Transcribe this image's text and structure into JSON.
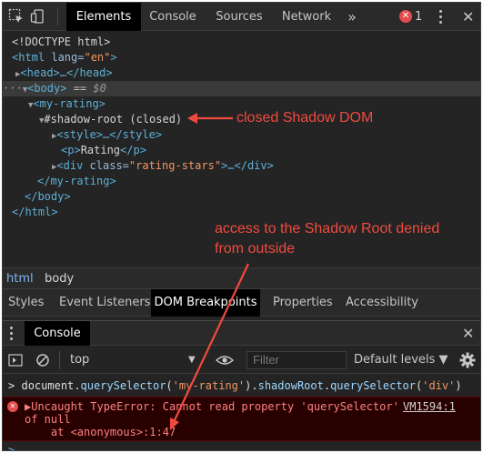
{
  "toolbar": {
    "inspect_icon": "inspect-cursor-icon",
    "device_icon": "device-toggle-icon",
    "tabs": [
      "Elements",
      "Console",
      "Sources",
      "Network"
    ],
    "overflow": "»",
    "error_count": "1",
    "accent_color": "#e34d4d"
  },
  "tree": {
    "doctype": "<!DOCTYPE html>",
    "html_open_tag": "<html",
    "html_lang_attr": " lang=",
    "html_lang_val": "\"en\"",
    "html_close_bracket": ">",
    "head": "<head>…</head>",
    "body_prefix": "···",
    "body_tag": "<body>",
    "body_suffix": " == ",
    "body_var": "$0",
    "my_rating_open": "<my-rating>",
    "shadow_root": "#shadow-root (closed)",
    "style": "<style>…</style>",
    "p_open": "<p>",
    "p_text": "Rating",
    "p_close": "</p>",
    "div_open": "<div",
    "div_class_attr": " class=",
    "div_class_val": "\"rating-stars\"",
    "div_rest": ">…</div>",
    "my_rating_close": "</my-rating>",
    "body_close": "</body>",
    "html_close": "</html>"
  },
  "annotations": {
    "shadow_label": "closed Shadow DOM",
    "denied_line1": "access to the Shadow Root denied",
    "denied_line2": "from outside",
    "color": "#f04a3f"
  },
  "breadcrumb": [
    "html",
    "body"
  ],
  "subtabs": [
    "Styles",
    "Event Listeners",
    "DOM Breakpoints",
    "Properties",
    "Accessibility"
  ],
  "drawer": {
    "title": "Console",
    "context": "top",
    "filter_placeholder": "Filter",
    "levels": "Default levels ▼"
  },
  "console": {
    "prompt": ">",
    "cmd_p1": "document.",
    "cmd_fn1": "querySelector",
    "cmd_p2": "(",
    "cmd_str1": "'my-rating'",
    "cmd_p3": ").",
    "cmd_fn2": "shadowRoot",
    "cmd_p4": ".",
    "cmd_fn3": "querySelector",
    "cmd_p5": "(",
    "cmd_str2": "'div'",
    "cmd_p6": ")",
    "error_line1": "▶Uncaught TypeError: Cannot read property 'querySelector'",
    "error_source": "VM1594:1",
    "error_line2": "of null",
    "error_line3": "    at <anonymous>:1:47",
    "input_prompt": ">"
  }
}
